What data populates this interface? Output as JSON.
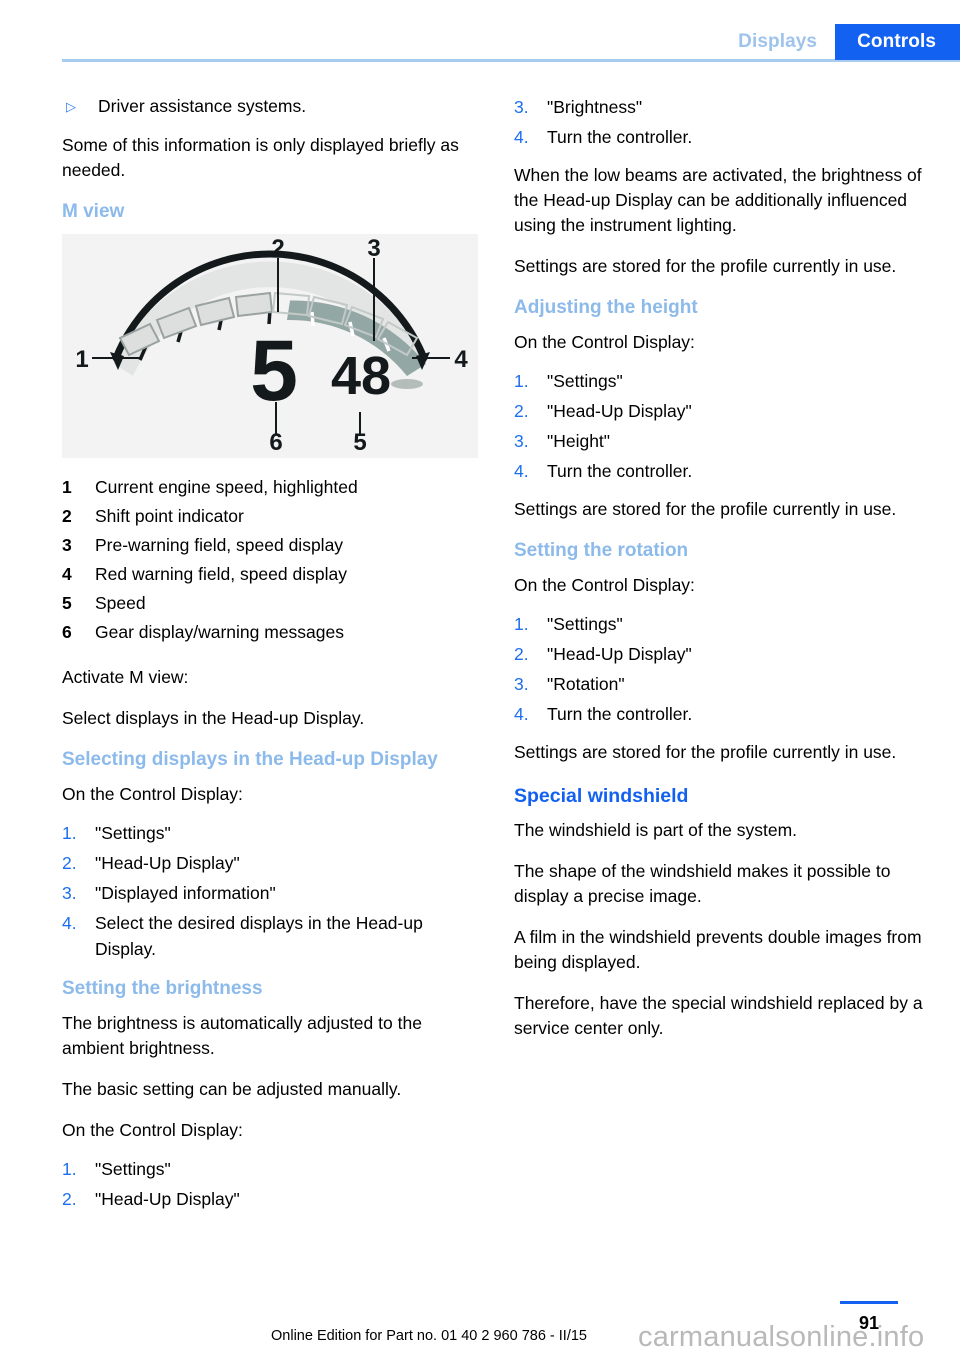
{
  "header": {
    "tab_inactive": "Displays",
    "tab_active": "Controls",
    "accent_blue": "#1261f0",
    "tab_inactive_color": "#9ec3ec",
    "rule_color": "#a8cbf0"
  },
  "left": {
    "bullet": {
      "glyph": "▷",
      "text": "Driver assistance systems."
    },
    "intro_paragraph": "Some of this information is only displayed briefly as needed.",
    "m_view_heading": "M view",
    "figure": {
      "name": "m-view-head-up-display-gauge",
      "background": "#f2f3f2",
      "callouts": [
        "1",
        "2",
        "3",
        "4",
        "5",
        "6"
      ],
      "gear_value": "5",
      "speed_value": "48"
    },
    "legend": [
      {
        "num": "1",
        "text": "Current engine speed, highlighted"
      },
      {
        "num": "2",
        "text": "Shift point indicator"
      },
      {
        "num": "3",
        "text": "Pre-warning field, speed display"
      },
      {
        "num": "4",
        "text": "Red warning field, speed display"
      },
      {
        "num": "5",
        "text": "Speed"
      },
      {
        "num": "6",
        "text": "Gear display/warning messages"
      }
    ],
    "activate_label": "Activate M view:",
    "activate_text": "Select displays in the Head-up Display.",
    "selecting_heading": "Selecting displays in the Head-up Display",
    "selecting_lead": "On the Control Display:",
    "selecting_steps": [
      {
        "num": "1.",
        "text": "\"Settings\""
      },
      {
        "num": "2.",
        "text": "\"Head-Up Display\""
      },
      {
        "num": "3.",
        "text": "\"Displayed information\""
      },
      {
        "num": "4.",
        "text": "Select the desired displays in the Head-up Display."
      }
    ],
    "brightness_heading": "Setting the brightness",
    "brightness_p1": "The brightness is automatically adjusted to the ambient brightness.",
    "brightness_p2": "The basic setting can be adjusted manually.",
    "brightness_lead": "On the Control Display:",
    "brightness_steps": [
      {
        "num": "1.",
        "text": "\"Settings\""
      },
      {
        "num": "2.",
        "text": "\"Head-Up Display\""
      }
    ]
  },
  "right": {
    "brightness_steps_cont": [
      {
        "num": "3.",
        "text": "\"Brightness\""
      },
      {
        "num": "4.",
        "text": "Turn the controller."
      }
    ],
    "brightness_note": "When the low beams are activated, the brightness of the Head-up Display can be additionally influenced using the instrument lighting.",
    "brightness_stored": "Settings are stored for the profile currently in use.",
    "height_heading": "Adjusting the height",
    "height_lead": "On the Control Display:",
    "height_steps": [
      {
        "num": "1.",
        "text": "\"Settings\""
      },
      {
        "num": "2.",
        "text": "\"Head-Up Display\""
      },
      {
        "num": "3.",
        "text": "\"Height\""
      },
      {
        "num": "4.",
        "text": "Turn the controller."
      }
    ],
    "height_stored": "Settings are stored for the profile currently in use.",
    "rotation_heading": "Setting the rotation",
    "rotation_lead": "On the Control Display:",
    "rotation_steps": [
      {
        "num": "1.",
        "text": "\"Settings\""
      },
      {
        "num": "2.",
        "text": "\"Head-Up Display\""
      },
      {
        "num": "3.",
        "text": "\"Rotation\""
      },
      {
        "num": "4.",
        "text": "Turn the controller."
      }
    ],
    "rotation_stored": "Settings are stored for the profile currently in use.",
    "windshield_heading": "Special windshield",
    "windshield_p1": "The windshield is part of the system.",
    "windshield_p2": "The shape of the windshield makes it possible to display a precise image.",
    "windshield_p3": "A film in the windshield prevents double images from being displayed.",
    "windshield_p4": "Therefore, have the special windshield replaced by a service center only."
  },
  "footer": {
    "edition": "Online Edition for Part no. 01 40 2 960 786 - II/15",
    "page_number": "91",
    "watermark": "carmanualsonline.info"
  }
}
